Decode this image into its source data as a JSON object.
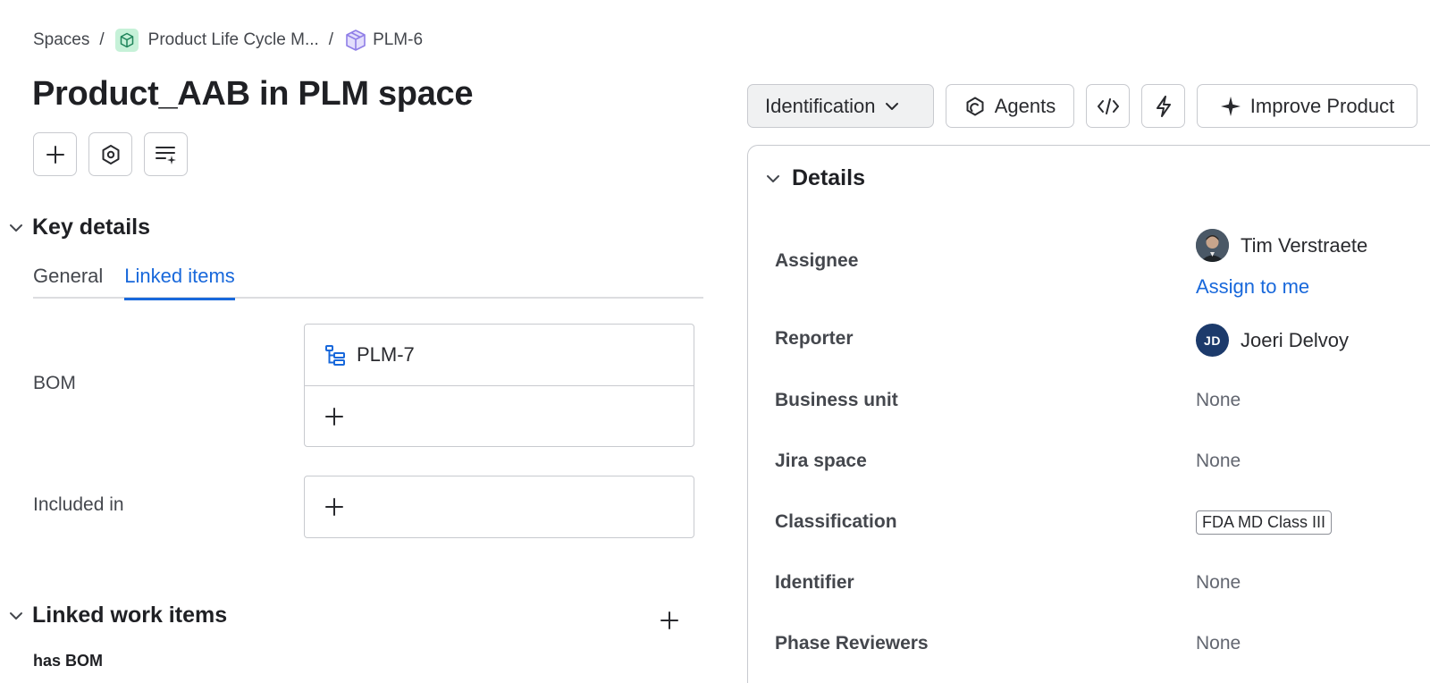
{
  "breadcrumb": {
    "spaces": "Spaces",
    "separator": "/",
    "project": "Product Life Cycle M...",
    "issue": "PLM-6"
  },
  "title": "Product_AAB in PLM space",
  "key_details": {
    "heading": "Key details",
    "tabs": [
      "General",
      "Linked items"
    ],
    "active_tab": "Linked items",
    "fields": {
      "bom": {
        "label": "BOM",
        "items": [
          "PLM-7"
        ]
      },
      "included_in": {
        "label": "Included in",
        "items": []
      }
    }
  },
  "linked_work_items": {
    "heading": "Linked work items",
    "subheading": "has BOM"
  },
  "toolbar": {
    "identification": "Identification",
    "agents": "Agents",
    "improve": "Improve Product"
  },
  "details": {
    "heading": "Details",
    "assignee": {
      "label": "Assignee",
      "name": "Tim Verstraete",
      "assign_to_me": "Assign to me"
    },
    "reporter": {
      "label": "Reporter",
      "name": "Joeri Delvoy",
      "initials": "JD"
    },
    "business_unit": {
      "label": "Business unit",
      "value": "None"
    },
    "jira_space": {
      "label": "Jira space",
      "value": "None"
    },
    "classification": {
      "label": "Classification",
      "value": "FDA MD Class III"
    },
    "identifier": {
      "label": "Identifier",
      "value": "None"
    },
    "phase_reviewers": {
      "label": "Phase Reviewers",
      "value": "None"
    }
  },
  "colors": {
    "link": "#1868db",
    "project_icon_bg": "#c6f1d8",
    "issue_icon": "#8f7ee7",
    "reporter_avatar": "#1c3a6b"
  },
  "icons": {
    "project": "cube-icon",
    "issue": "box-icon",
    "bom_item": "hierarchy-icon",
    "agents": "agents-icon",
    "code": "code-icon",
    "automation": "lightning-icon",
    "improve": "sparkle-icon"
  }
}
